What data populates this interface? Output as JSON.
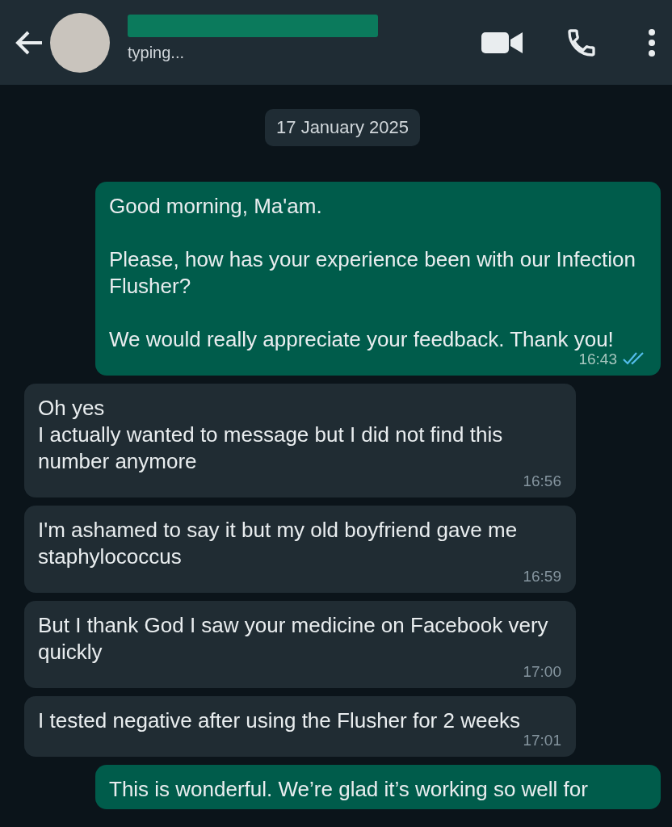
{
  "header": {
    "status_text": "typing..."
  },
  "date_chip": "17 January 2025",
  "messages": [
    {
      "kind": "outgoing",
      "text": "Good morning, Ma'am.\n\nPlease, how has your experience been with our Infection Flusher?\n\nWe would really appreciate your feedback. Thank you!",
      "time": "16:43",
      "read": true
    },
    {
      "kind": "incoming",
      "text": "Oh yes\nI actually wanted to message but I did not find this number anymore",
      "time": "16:56"
    },
    {
      "kind": "incoming",
      "text": "I'm ashamed to say it but my old boyfriend gave me staphylococcus",
      "time": "16:59"
    },
    {
      "kind": "incoming",
      "text": "But I thank God I saw your medicine on Facebook very quickly",
      "time": "17:00"
    },
    {
      "kind": "incoming",
      "text": "I tested negative after using the Flusher for 2 weeks",
      "time": "17:01"
    },
    {
      "kind": "outgoing",
      "text": "This is wonderful. We’re glad it’s working so well for"
    }
  ]
}
